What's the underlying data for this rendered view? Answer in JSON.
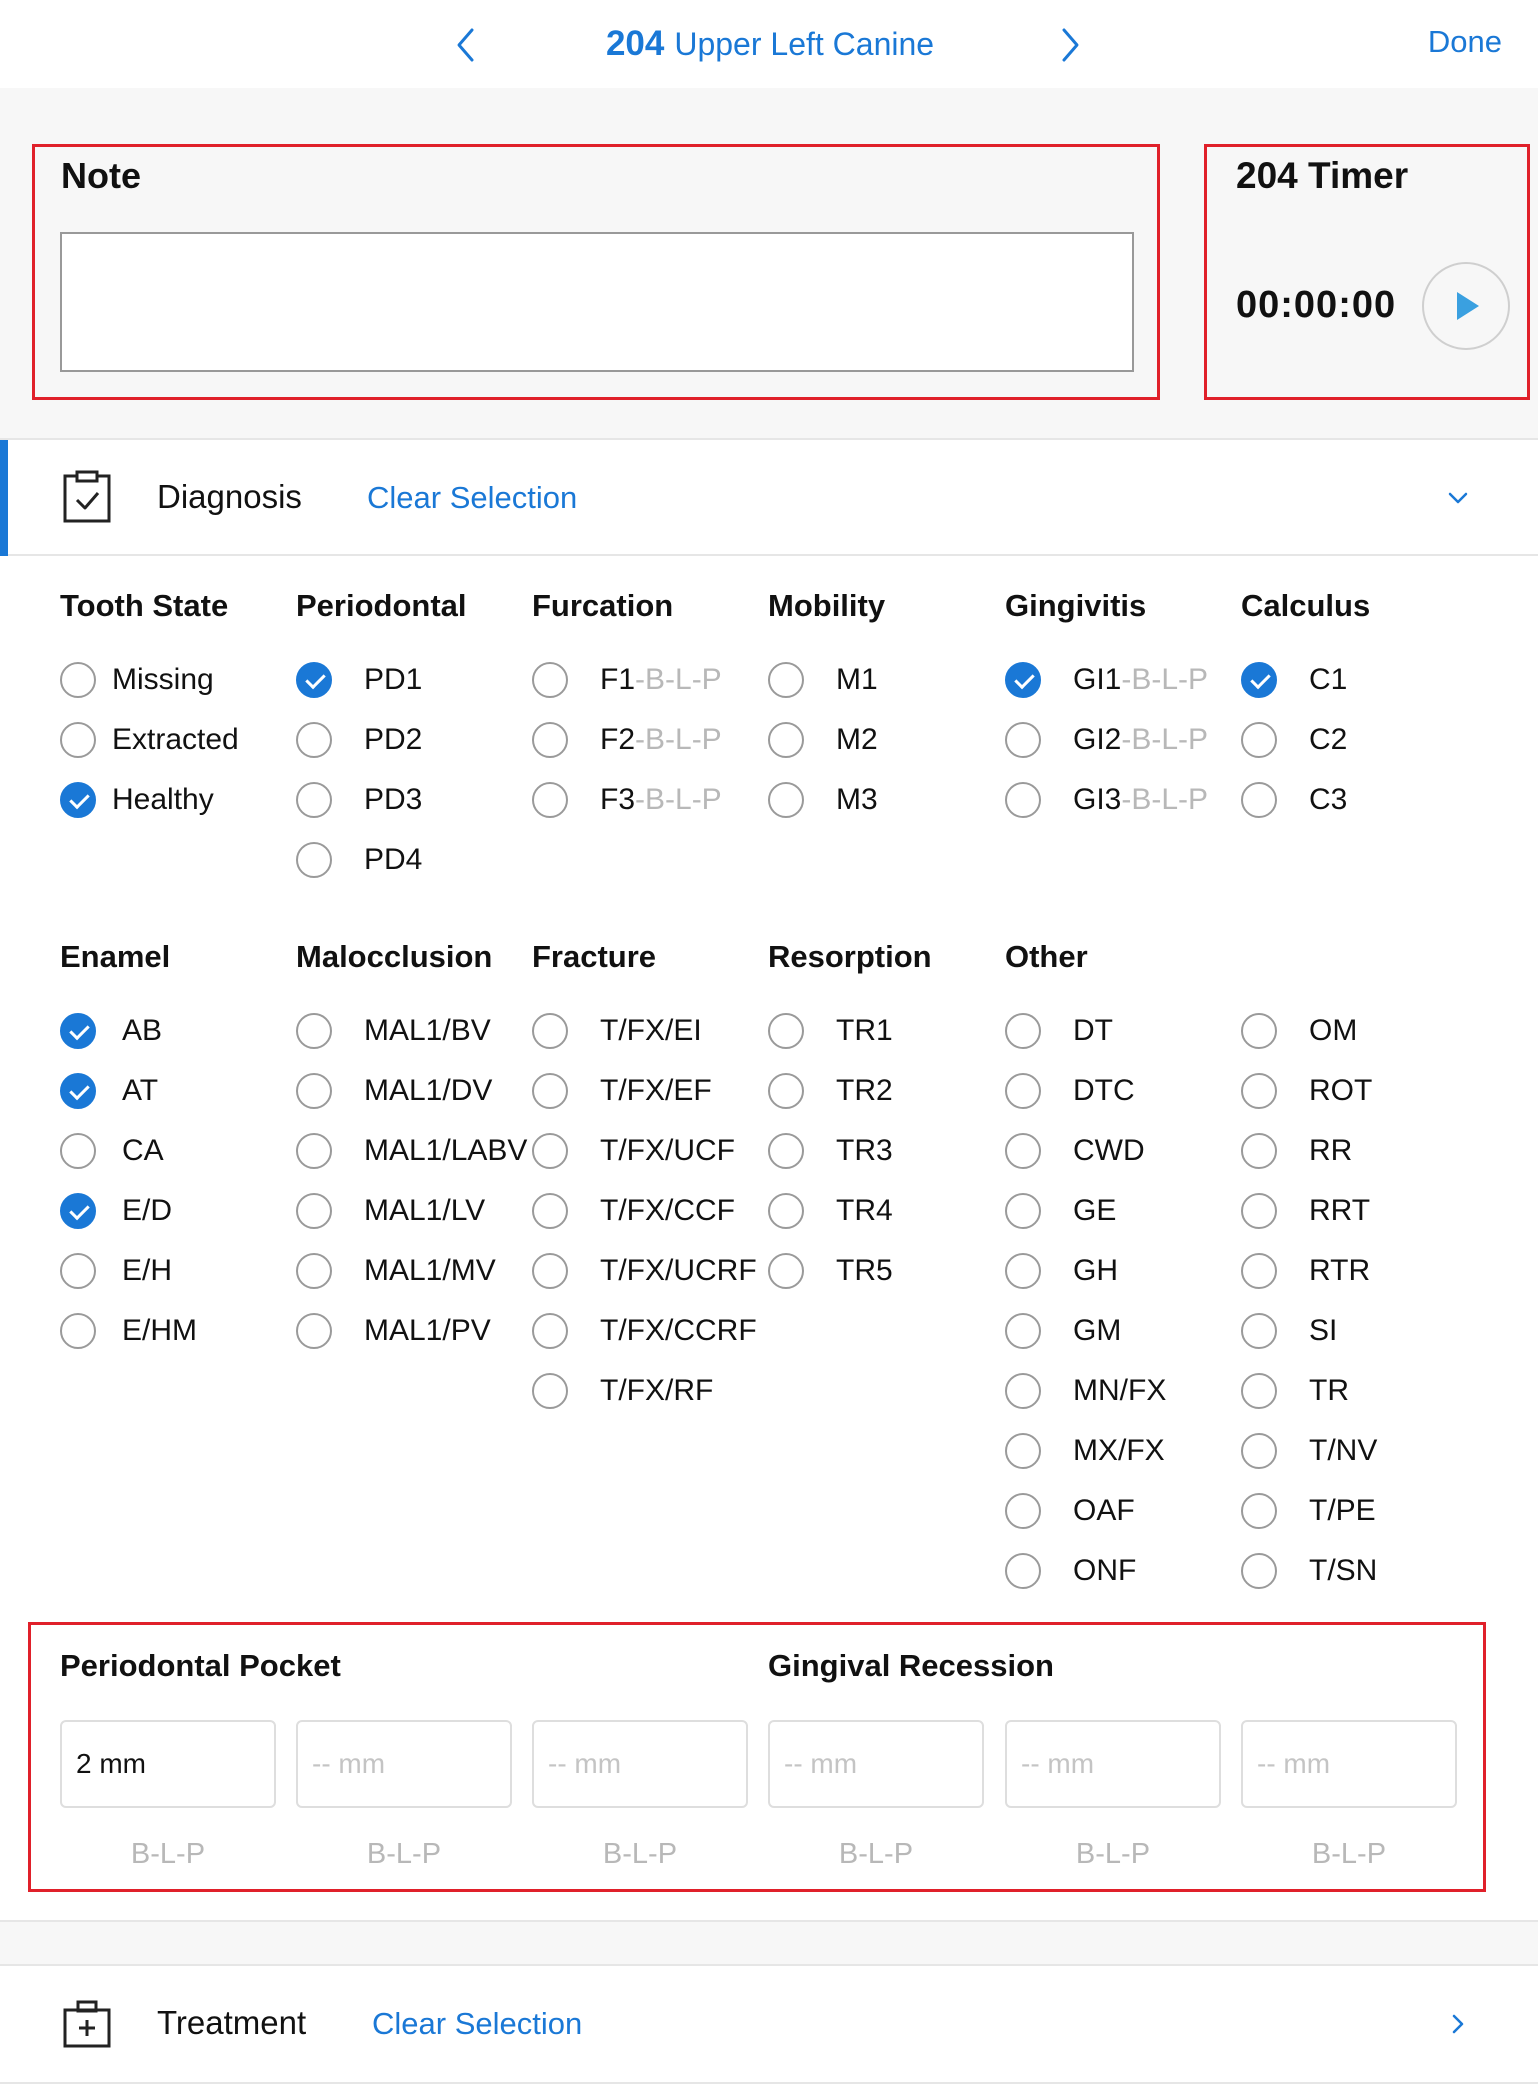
{
  "header": {
    "tooth_number": "204",
    "tooth_name": "Upper Left Canine",
    "done_label": "Done"
  },
  "note": {
    "title": "Note",
    "value": ""
  },
  "timer": {
    "title": "204 Timer",
    "time": "00:00:00"
  },
  "diagnosis": {
    "label": "Diagnosis",
    "clear_label": "Clear Selection"
  },
  "groups": {
    "tooth_state": {
      "title": "Tooth State",
      "options": [
        {
          "label": "Missing",
          "checked": false
        },
        {
          "label": "Extracted",
          "checked": false
        },
        {
          "label": "Healthy",
          "checked": true
        }
      ]
    },
    "periodontal": {
      "title": "Periodontal",
      "options": [
        {
          "label": "PD1",
          "checked": true
        },
        {
          "label": "PD2",
          "checked": false
        },
        {
          "label": "PD3",
          "checked": false
        },
        {
          "label": "PD4",
          "checked": false
        }
      ]
    },
    "furcation": {
      "title": "Furcation",
      "options": [
        {
          "label": "F1",
          "suffix": "-B-L-P",
          "checked": false
        },
        {
          "label": "F2",
          "suffix": "-B-L-P",
          "checked": false
        },
        {
          "label": "F3",
          "suffix": "-B-L-P",
          "checked": false
        }
      ]
    },
    "mobility": {
      "title": "Mobility",
      "options": [
        {
          "label": "M1",
          "checked": false
        },
        {
          "label": "M2",
          "checked": false
        },
        {
          "label": "M3",
          "checked": false
        }
      ]
    },
    "gingivitis": {
      "title": "Gingivitis",
      "options": [
        {
          "label": "GI1",
          "suffix": "-B-L-P",
          "checked": true
        },
        {
          "label": "GI2",
          "suffix": "-B-L-P",
          "checked": false
        },
        {
          "label": "GI3",
          "suffix": "-B-L-P",
          "checked": false
        }
      ]
    },
    "calculus": {
      "title": "Calculus",
      "options": [
        {
          "label": "C1",
          "checked": true
        },
        {
          "label": "C2",
          "checked": false
        },
        {
          "label": "C3",
          "checked": false
        }
      ]
    },
    "enamel": {
      "title": "Enamel",
      "options": [
        {
          "label": "AB",
          "checked": true
        },
        {
          "label": "AT",
          "checked": true
        },
        {
          "label": "CA",
          "checked": false
        },
        {
          "label": "E/D",
          "checked": true
        },
        {
          "label": "E/H",
          "checked": false
        },
        {
          "label": "E/HM",
          "checked": false
        }
      ]
    },
    "malocclusion": {
      "title": "Malocclusion",
      "options": [
        {
          "label": "MAL1/BV",
          "checked": false
        },
        {
          "label": "MAL1/DV",
          "checked": false
        },
        {
          "label": "MAL1/LABV",
          "checked": false
        },
        {
          "label": "MAL1/LV",
          "checked": false
        },
        {
          "label": "MAL1/MV",
          "checked": false
        },
        {
          "label": "MAL1/PV",
          "checked": false
        }
      ]
    },
    "fracture": {
      "title": "Fracture",
      "options": [
        {
          "label": "T/FX/EI",
          "checked": false
        },
        {
          "label": "T/FX/EF",
          "checked": false
        },
        {
          "label": "T/FX/UCF",
          "checked": false
        },
        {
          "label": "T/FX/CCF",
          "checked": false
        },
        {
          "label": "T/FX/UCRF",
          "checked": false
        },
        {
          "label": "T/FX/CCRF",
          "checked": false
        },
        {
          "label": "T/FX/RF",
          "checked": false
        }
      ]
    },
    "resorption": {
      "title": "Resorption",
      "options": [
        {
          "label": "TR1",
          "checked": false
        },
        {
          "label": "TR2",
          "checked": false
        },
        {
          "label": "TR3",
          "checked": false
        },
        {
          "label": "TR4",
          "checked": false
        },
        {
          "label": "TR5",
          "checked": false
        }
      ]
    },
    "other": {
      "title": "Other",
      "options": [
        {
          "label": "DT",
          "checked": false
        },
        {
          "label": "DTC",
          "checked": false
        },
        {
          "label": "CWD",
          "checked": false
        },
        {
          "label": "GE",
          "checked": false
        },
        {
          "label": "GH",
          "checked": false
        },
        {
          "label": "GM",
          "checked": false
        },
        {
          "label": "MN/FX",
          "checked": false
        },
        {
          "label": "MX/FX",
          "checked": false
        },
        {
          "label": "OAF",
          "checked": false
        },
        {
          "label": "ONF",
          "checked": false
        }
      ]
    },
    "other2": {
      "title": "",
      "options": [
        {
          "label": "OM",
          "checked": false
        },
        {
          "label": "ROT",
          "checked": false
        },
        {
          "label": "RR",
          "checked": false
        },
        {
          "label": "RRT",
          "checked": false
        },
        {
          "label": "RTR",
          "checked": false
        },
        {
          "label": "SI",
          "checked": false
        },
        {
          "label": "TR",
          "checked": false
        },
        {
          "label": "T/NV",
          "checked": false
        },
        {
          "label": "T/PE",
          "checked": false
        },
        {
          "label": "T/SN",
          "checked": false
        }
      ]
    }
  },
  "measurements": {
    "pocket_title": "Periodontal Pocket",
    "recession_title": "Gingival Recession",
    "placeholder": "-- mm",
    "fields": [
      {
        "value": "2 mm",
        "caption": "B-L-P"
      },
      {
        "value": "",
        "caption": "B-L-P"
      },
      {
        "value": "",
        "caption": "B-L-P"
      },
      {
        "value": "",
        "caption": "B-L-P"
      },
      {
        "value": "",
        "caption": "B-L-P"
      },
      {
        "value": "",
        "caption": "B-L-P"
      }
    ]
  },
  "treatment": {
    "label": "Treatment",
    "clear_label": "Clear Selection"
  },
  "colors": {
    "accent": "#1a78d6",
    "highlight_border": "#e0202a",
    "play_icon": "#3aa0e0",
    "muted_text": "#b8b8b8"
  },
  "icons": {
    "prev": "chevron-left-icon",
    "next": "chevron-right-icon",
    "play": "play-icon",
    "diagnosis": "clipboard-check-icon",
    "diagnosis_toggle": "chevron-down-icon",
    "treatment": "first-aid-kit-icon",
    "treatment_toggle": "chevron-right-icon"
  }
}
